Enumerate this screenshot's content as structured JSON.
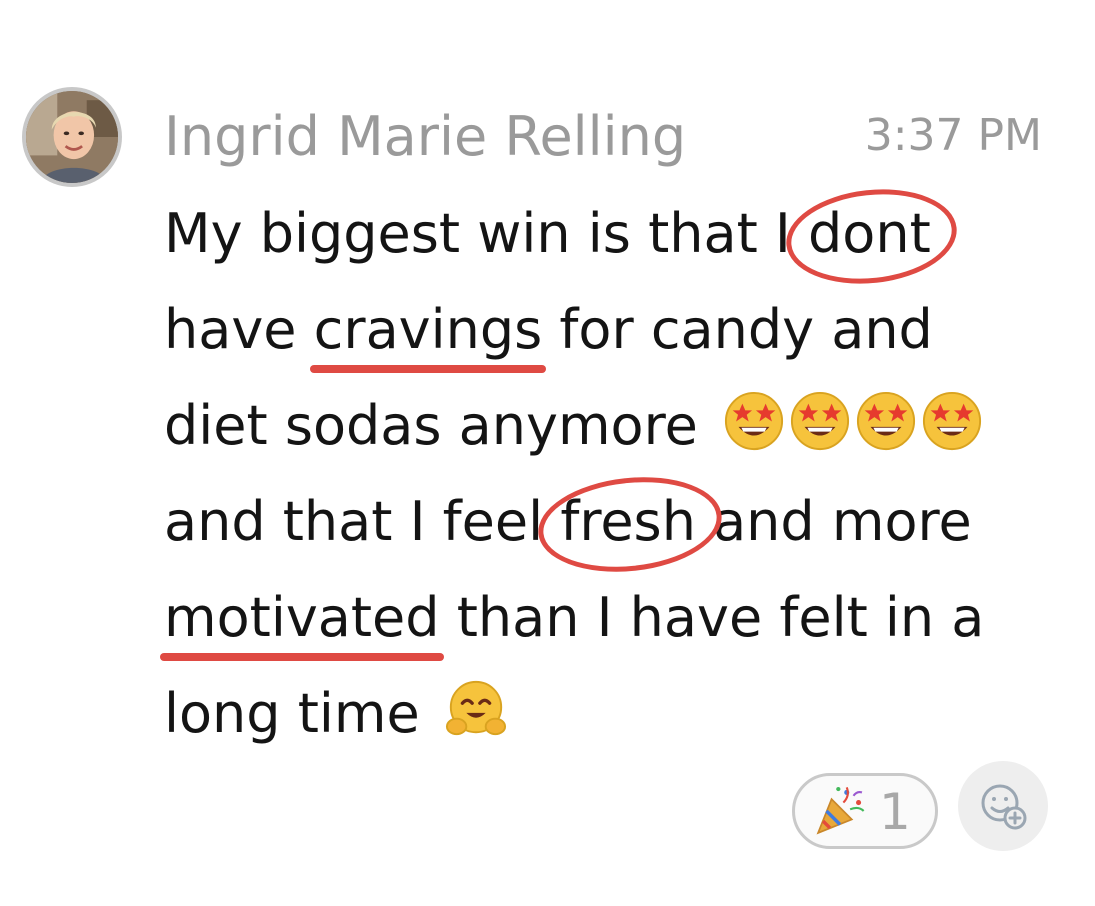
{
  "message": {
    "author": "Ingrid Marie Relling",
    "timestamp": "3:37 PM",
    "lines": [
      {
        "segments": [
          "My biggest win is that I ",
          "dont"
        ]
      },
      {
        "segments": [
          "have ",
          "cravings",
          " for candy and"
        ]
      },
      {
        "segments": [
          "diet sodas anymore"
        ]
      },
      {
        "segments": [
          "and that I feel ",
          "fresh",
          " and more"
        ]
      },
      {
        "segments": [
          "motivated",
          " than I have felt in a"
        ]
      },
      {
        "segments": [
          "long time"
        ]
      }
    ],
    "emojis": {
      "star_struck": "star-struck-emoji",
      "hugging": "hugging-face-emoji",
      "party_popper": "party-popper-emoji"
    }
  },
  "reactions": [
    {
      "emoji": "party-popper-emoji",
      "count": "1"
    }
  ],
  "add_reaction": {
    "icon": "add-reaction-icon"
  },
  "colors": {
    "annotation_red": "#df4a43",
    "muted_text": "#9a9a9a"
  }
}
